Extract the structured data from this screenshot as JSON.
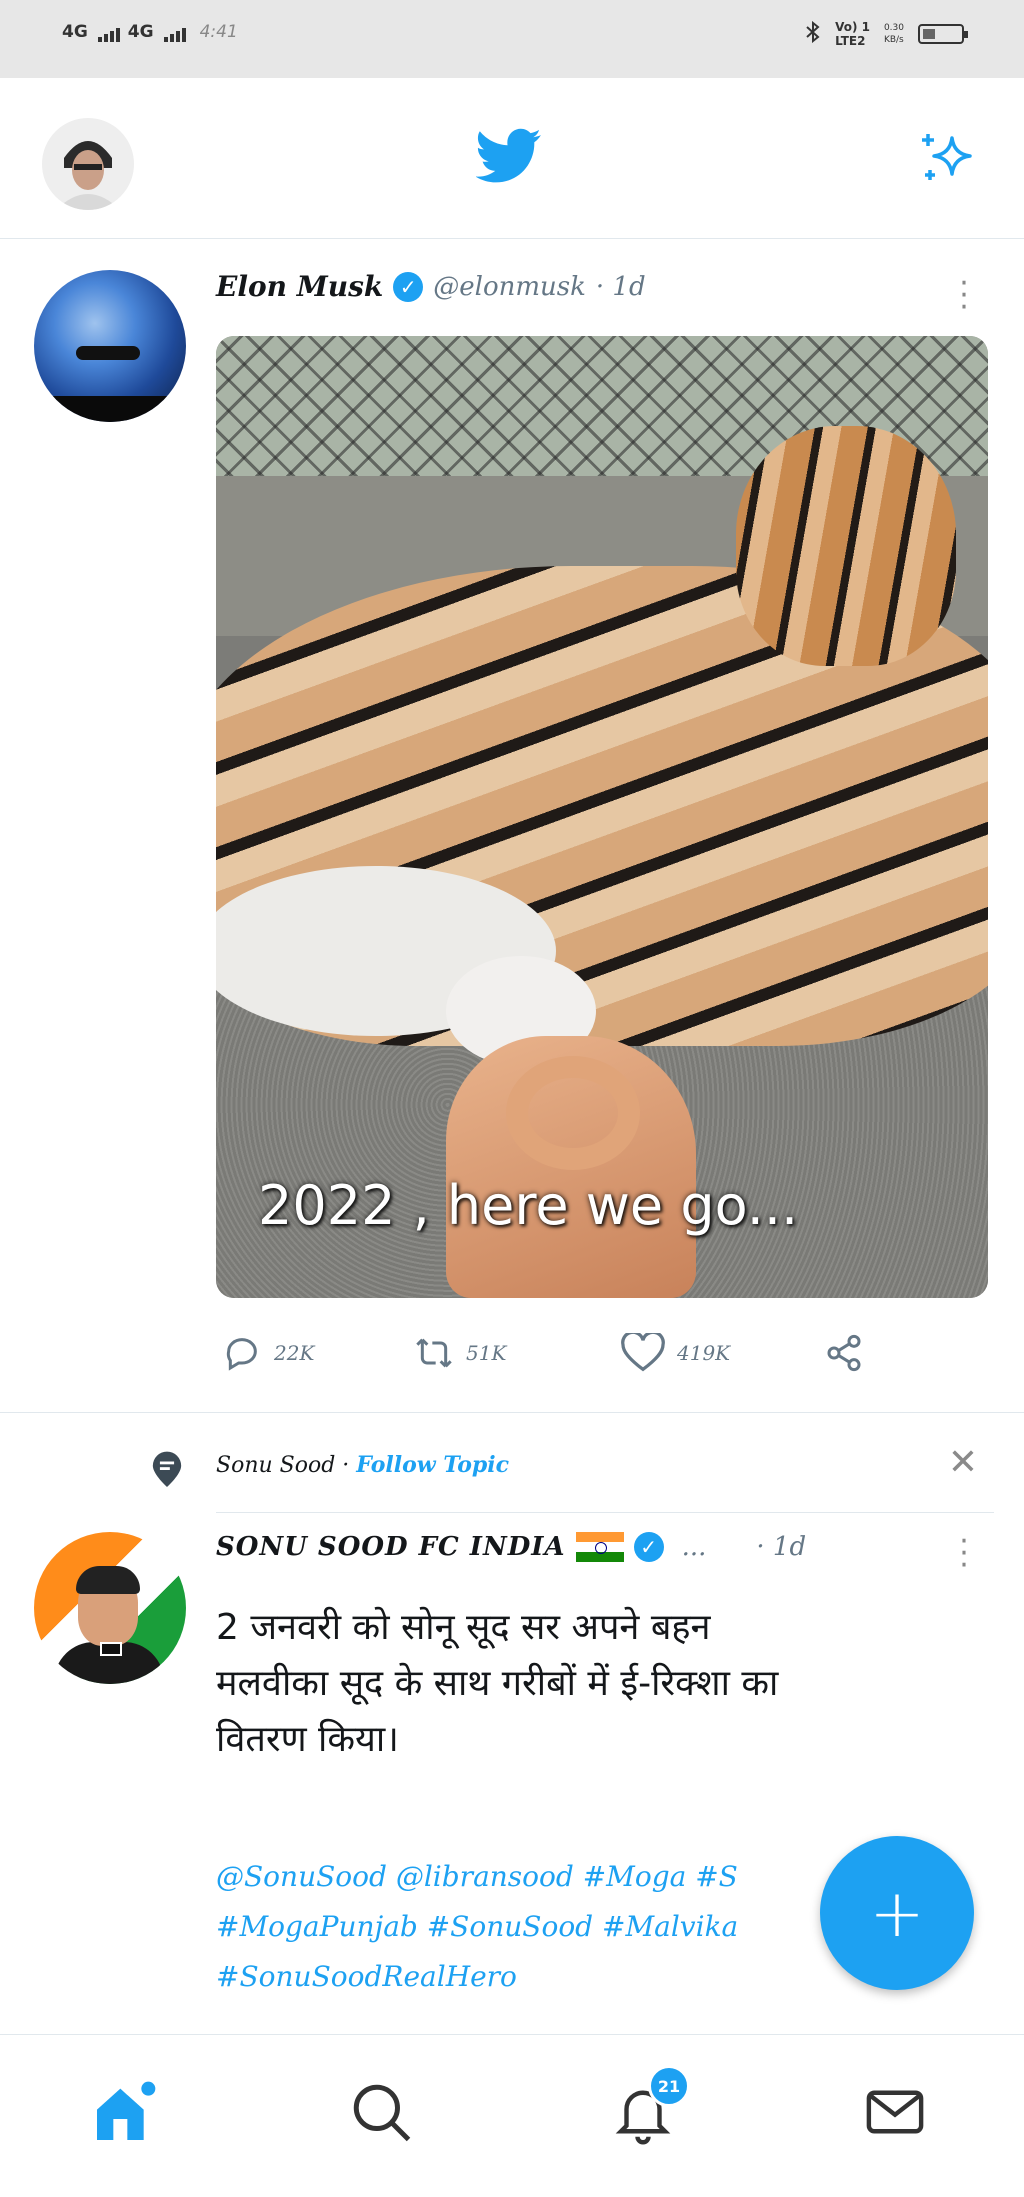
{
  "status_bar": {
    "network1": "4G",
    "network2": "4G",
    "time": "4:41",
    "volte": "Vo) 1",
    "lte": "LTE2",
    "speed": "0.30",
    "speed_unit": "KB/s"
  },
  "header": {
    "logo_icon": "twitter-bird-icon",
    "sparkle_icon": "sparkle-icon",
    "accent": "#1da1f2"
  },
  "tweet1": {
    "display_name": "Elon Musk",
    "handle": "@elonmusk",
    "time": "· 1d",
    "media_caption": "2022 , here we go...",
    "replies": "22K",
    "retweets": "51K",
    "likes": "419K"
  },
  "topic": {
    "name": "Sonu Sood",
    "separator": "·",
    "follow_label": "Follow Topic"
  },
  "tweet2": {
    "display_name": "SONU SOOD FC INDIA",
    "ellipsis": "...",
    "time": "· 1d",
    "text_lines": [
      "2 जनवरी को सोनू सूद सर अपने बहन",
      "मलवीका सूद के साथ गरीबों में ई-रिक्शा का",
      "वितरण किया।"
    ],
    "tags_line1": [
      "@SonuSood",
      "@libransood",
      "#Moga",
      "#S"
    ],
    "tags_line2": [
      "#MogaPunjab",
      "#SonuSood",
      "#Malvika"
    ],
    "tags_line3": [
      "#SonuSoodRealHero"
    ]
  },
  "fab": {
    "label": "+"
  },
  "bottom_nav": {
    "items": [
      "home-icon",
      "search-icon",
      "notifications-icon",
      "messages-icon"
    ],
    "notification_count": "21"
  }
}
